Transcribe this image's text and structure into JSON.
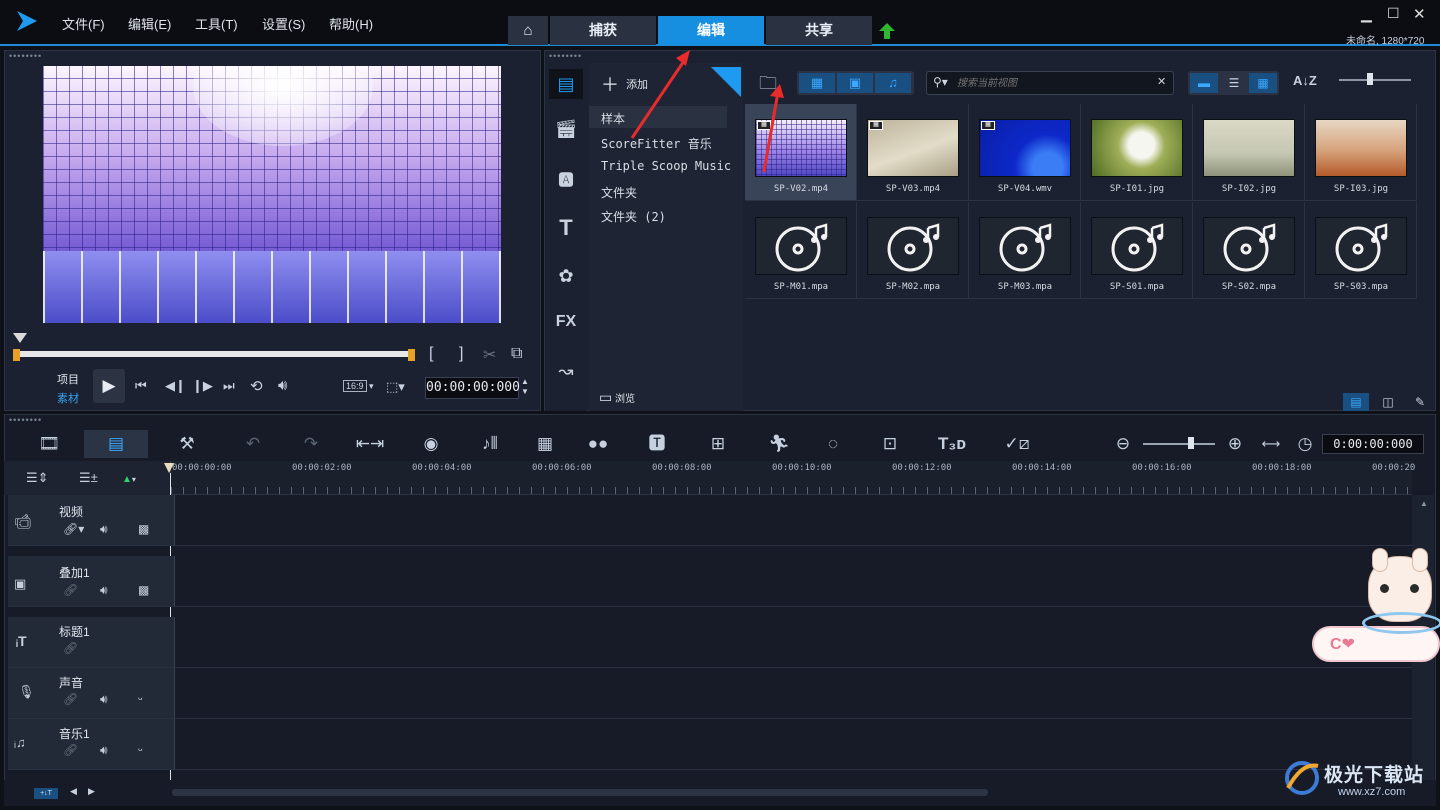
{
  "menu": [
    "文件(F)",
    "编辑(E)",
    "工具(T)",
    "设置(S)",
    "帮助(H)"
  ],
  "tabs": {
    "capture": "捕获",
    "edit": "编辑",
    "share": "共享"
  },
  "project_info": "未命名, 1280*720",
  "player": {
    "project_label": "项目",
    "clip_label": "素材",
    "aspect": "16:9",
    "timecode": "00:00:00:000"
  },
  "library": {
    "add_label": "添加",
    "folders": [
      "样本",
      "ScoreFitter 音乐",
      "Triple Scoop Music",
      "文件夹",
      "文件夹 (2)"
    ],
    "browse_label": "浏览",
    "search_placeholder": "搜索当前视图"
  },
  "media": [
    {
      "name": "SP-V02.mp4",
      "kind": "video",
      "selected": true
    },
    {
      "name": "SP-V03.mp4",
      "kind": "video"
    },
    {
      "name": "SP-V04.wmv",
      "kind": "video"
    },
    {
      "name": "SP-I01.jpg",
      "kind": "image"
    },
    {
      "name": "SP-I02.jpg",
      "kind": "image"
    },
    {
      "name": "SP-I03.jpg",
      "kind": "image"
    },
    {
      "name": "SP-M01.mpa",
      "kind": "audio"
    },
    {
      "name": "SP-M02.mpa",
      "kind": "audio"
    },
    {
      "name": "SP-M03.mpa",
      "kind": "audio"
    },
    {
      "name": "SP-S01.mpa",
      "kind": "audio"
    },
    {
      "name": "SP-S02.mpa",
      "kind": "audio"
    },
    {
      "name": "SP-S03.mpa",
      "kind": "audio"
    }
  ],
  "timeline": {
    "timecode": "0:00:00:000",
    "ruler": [
      "00:00:00:00",
      "00:00:02:00",
      "00:00:04:00",
      "00:00:06:00",
      "00:00:08:00",
      "00:00:10:00",
      "00:00:12:00",
      "00:00:14:00",
      "00:00:16:00",
      "00:00:18:00",
      "00:00:20"
    ],
    "tracks": [
      "视频",
      "叠加1",
      "标题1",
      "声音",
      "音乐1"
    ]
  },
  "watermark": {
    "site": "极光下载站",
    "url": "www.xz7.com"
  },
  "colors": {
    "accent": "#168fe0",
    "bg": "#0e1118",
    "panel": "#1b2130"
  }
}
